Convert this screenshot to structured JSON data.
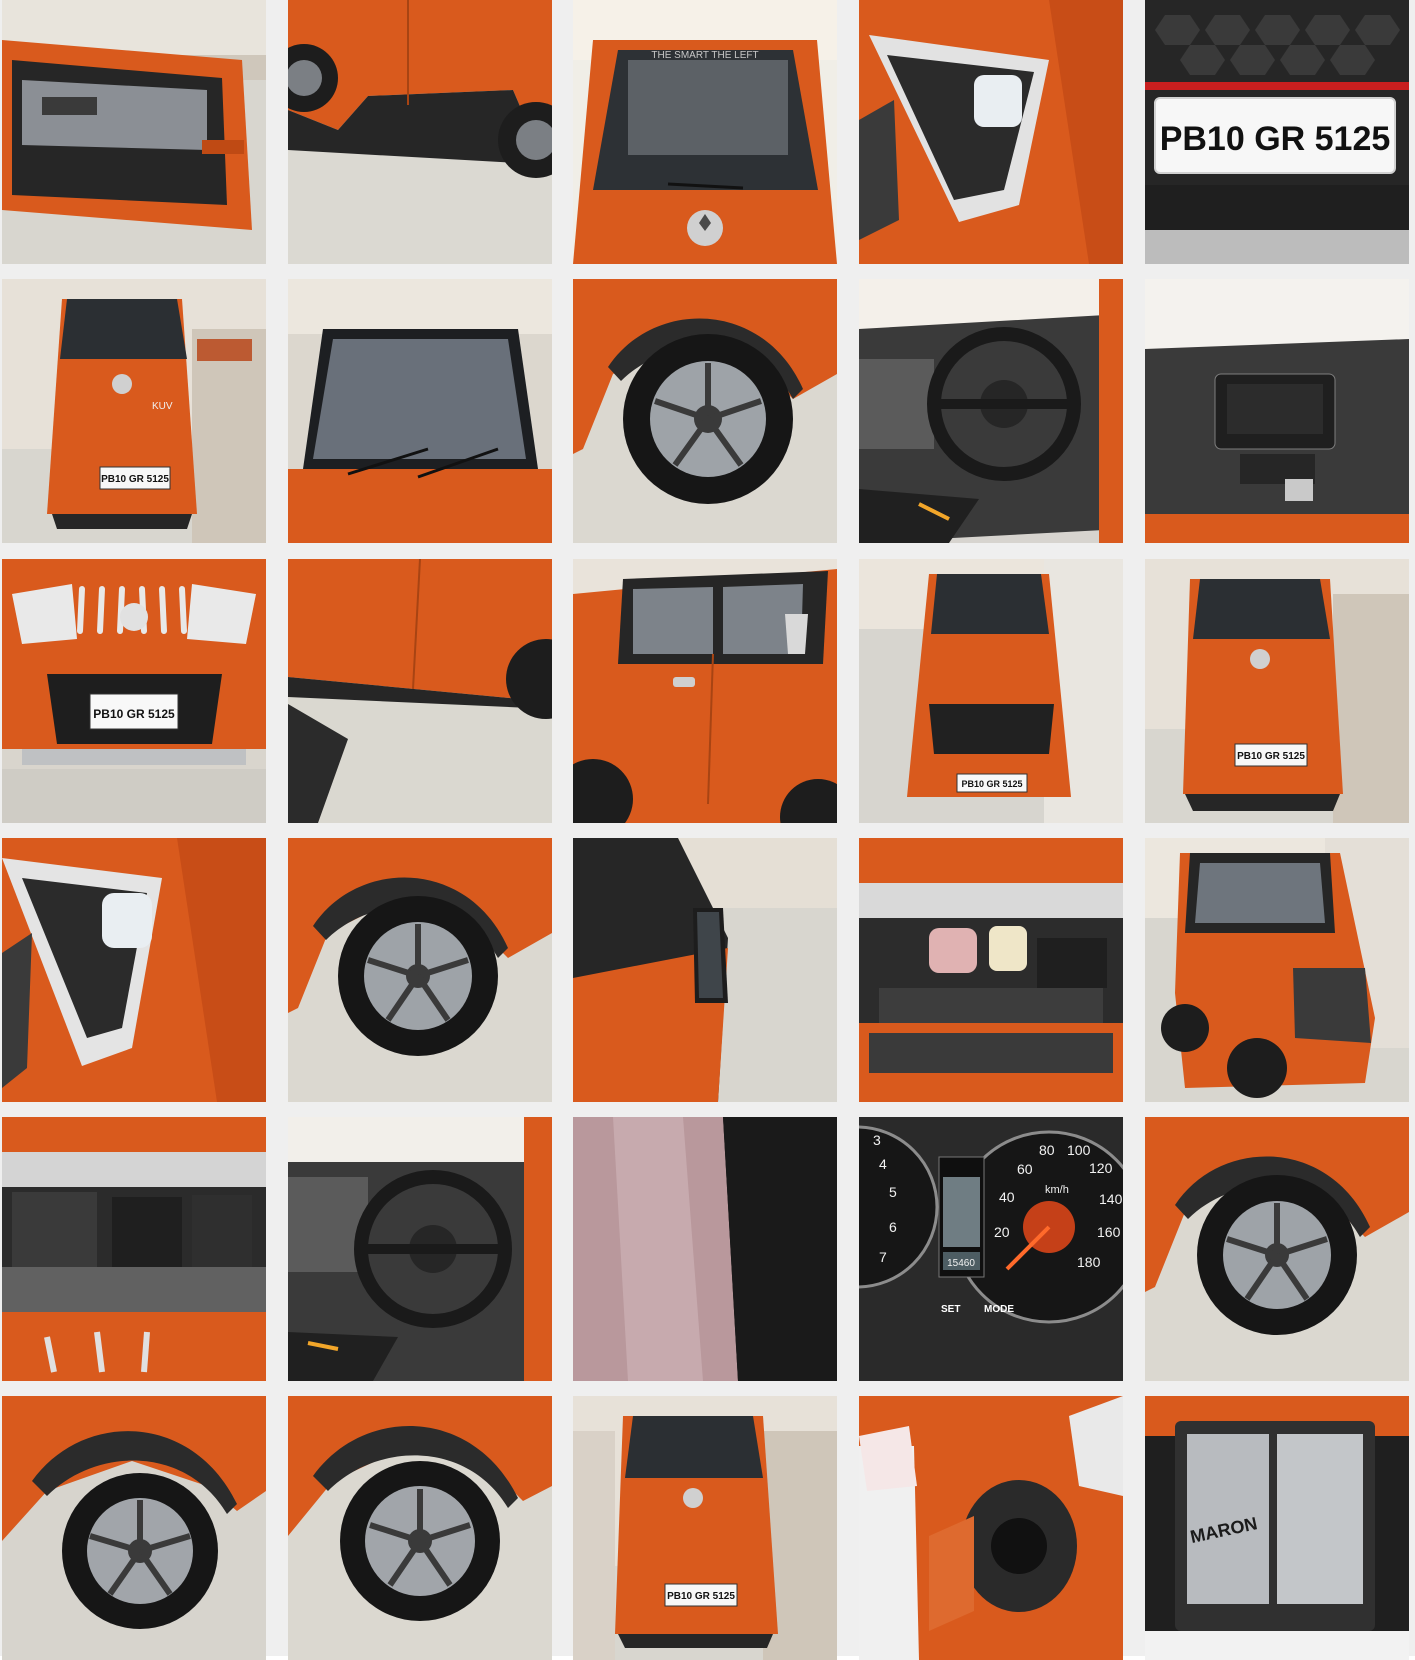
{
  "colors": {
    "page_background": "#efefef",
    "car_body": "#d95a1d",
    "car_dark": "#262626",
    "pavement": "#d8d6cf",
    "wall": "#e8e4dc"
  },
  "gallery": {
    "plate_text": "PB10 GR 5125",
    "speedometer_labels": [
      "20",
      "40",
      "60",
      "80",
      "100",
      "120",
      "140",
      "160",
      "180"
    ],
    "speed_unit": "km/h",
    "tach_labels": [
      "3",
      "4",
      "5",
      "6",
      "7"
    ],
    "odometer_reading": "15460",
    "cluster_buttons": [
      "SET",
      "MODE"
    ],
    "tailgate_script": "KUV",
    "battery_brand": "MARON",
    "tiles": [
      {
        "name": "driver-door-open-photo",
        "kind": "door_open"
      },
      {
        "name": "side-profile-photo",
        "kind": "side_profile"
      },
      {
        "name": "rear-glass-photo",
        "kind": "rear_glass"
      },
      {
        "name": "fog-lamp-closeup-photo",
        "kind": "foglamp"
      },
      {
        "name": "number-plate-closeup-photo",
        "kind": "plate_closeup"
      },
      {
        "name": "rear-full-view-photo-1",
        "kind": "rear_full"
      },
      {
        "name": "windshield-view-photo",
        "kind": "windshield"
      },
      {
        "name": "wheel-arch-photo-1",
        "kind": "wheel"
      },
      {
        "name": "steering-interior-photo-1",
        "kind": "steering"
      },
      {
        "name": "dashboard-console-photo",
        "kind": "console"
      },
      {
        "name": "front-grille-photo",
        "kind": "front"
      },
      {
        "name": "door-panel-photo",
        "kind": "door_panel"
      },
      {
        "name": "side-window-photo",
        "kind": "side_window"
      },
      {
        "name": "front-full-view-photo",
        "kind": "front_full"
      },
      {
        "name": "rear-full-view-photo-2",
        "kind": "rear_full"
      },
      {
        "name": "fog-lamp-closeup-photo-2",
        "kind": "foglamp"
      },
      {
        "name": "wheel-arch-photo-2",
        "kind": "wheel"
      },
      {
        "name": "side-mirror-photo",
        "kind": "mirror"
      },
      {
        "name": "engine-bay-photo-1",
        "kind": "engine"
      },
      {
        "name": "three-quarter-view-photo",
        "kind": "three_quarter"
      },
      {
        "name": "engine-bay-photo-2",
        "kind": "engine"
      },
      {
        "name": "steering-interior-photo-2",
        "kind": "steering"
      },
      {
        "name": "seat-fabric-photo",
        "kind": "fabric"
      },
      {
        "name": "instrument-cluster-photo",
        "kind": "cluster"
      },
      {
        "name": "wheel-arch-photo-3",
        "kind": "wheel"
      },
      {
        "name": "rear-wheel-photo",
        "kind": "wheel"
      },
      {
        "name": "wheel-arch-photo-4",
        "kind": "wheel"
      },
      {
        "name": "rear-full-view-photo-3",
        "kind": "rear_full"
      },
      {
        "name": "fuel-lid-photo",
        "kind": "fuel_lid"
      },
      {
        "name": "battery-photo",
        "kind": "battery"
      }
    ]
  }
}
